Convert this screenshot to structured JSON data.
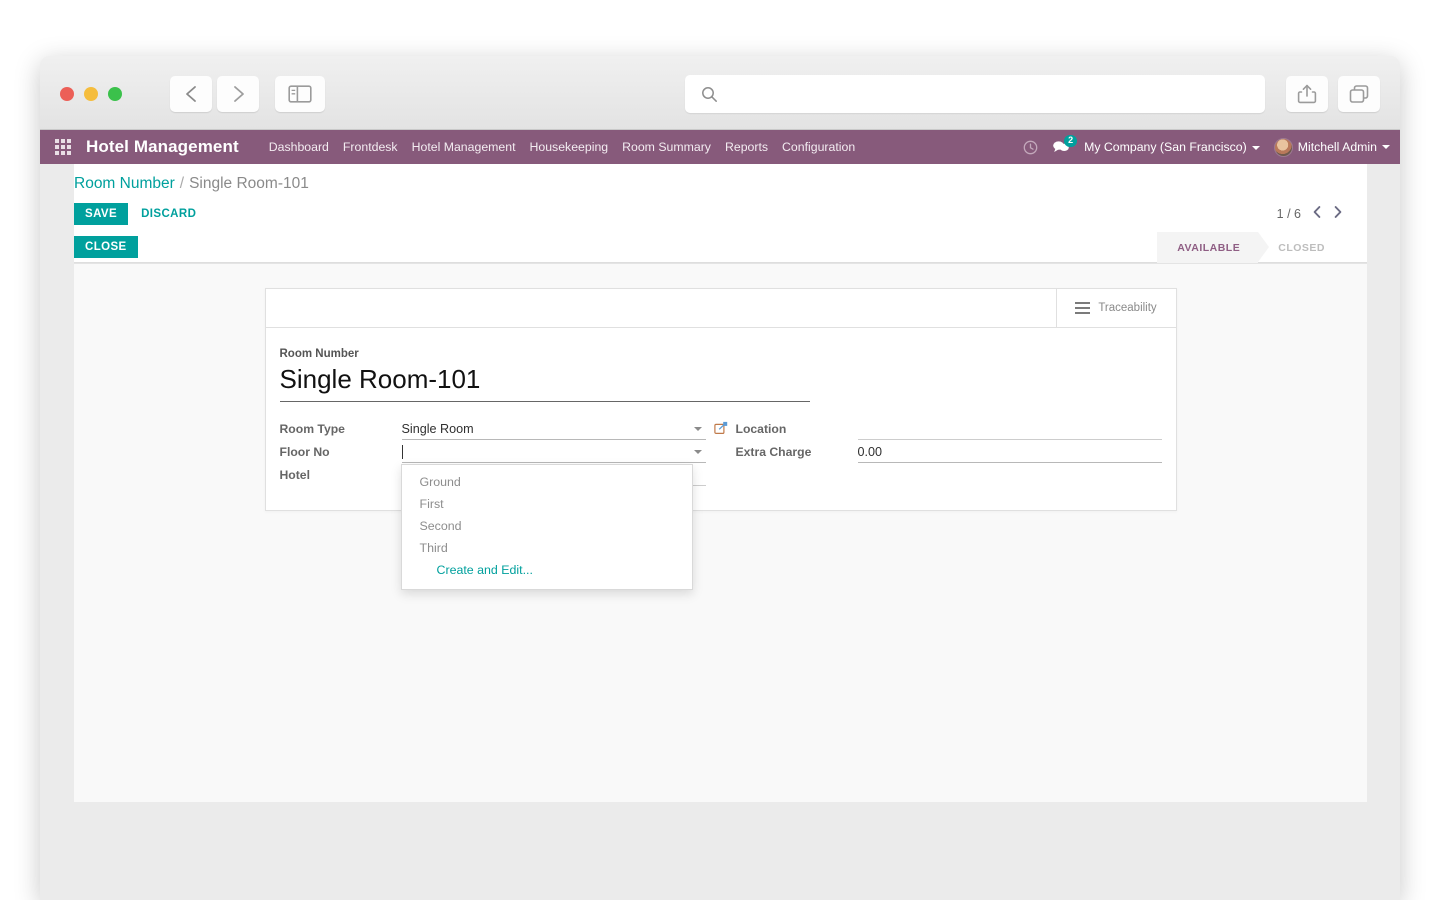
{
  "browser": {
    "search_value": "",
    "search_placeholder": "",
    "icons": {
      "back": "back-arrow-icon",
      "forward": "forward-arrow-icon",
      "sidebar": "sidebar-toggle-icon",
      "search": "search-icon",
      "share": "share-icon",
      "tabs": "tabs-icon"
    }
  },
  "navbar": {
    "apps_icon": "apps-grid-icon",
    "brand": "Hotel Management",
    "menu_items": [
      {
        "label": "Dashboard"
      },
      {
        "label": "Frontdesk"
      },
      {
        "label": "Hotel Management"
      },
      {
        "label": "Housekeeping"
      },
      {
        "label": "Room Summary"
      },
      {
        "label": "Reports"
      },
      {
        "label": "Configuration"
      }
    ],
    "activities_icon": "clock-icon",
    "messages_icon": "messages-icon",
    "message_count": "2",
    "company": "My Company (San Francisco)",
    "user": "Mitchell Admin",
    "brand_color": "#875A7B",
    "badge_color": "#00A09D"
  },
  "control_panel": {
    "breadcrumb_root": "Room Number",
    "breadcrumb_sep": "/",
    "breadcrumb_current": "Single Room-101",
    "save_label": "Save",
    "discard_label": "Discard",
    "pager_value": "1 / 6",
    "pager_prev_icon": "chevron-left-icon",
    "pager_next_icon": "chevron-right-icon"
  },
  "statusbar": {
    "close_label": "Close",
    "states": [
      {
        "label": "Available",
        "active": true
      },
      {
        "label": "Closed",
        "active": false
      }
    ],
    "active_color": "#8F5E84"
  },
  "form": {
    "button_box": {
      "traceability_label": "Traceability",
      "traceability_icon": "bars-icon"
    },
    "title_label": "Room Number",
    "title_value": "Single Room-101",
    "left_fields": [
      {
        "label": "Room Type",
        "value": "Single Room",
        "type": "many2one",
        "has_ext_link": true
      },
      {
        "label": "Floor No",
        "value": "",
        "type": "many2one",
        "has_ext_link": false
      },
      {
        "label": "Hotel",
        "value": "",
        "type": "many2one",
        "has_ext_link": false
      }
    ],
    "right_fields": [
      {
        "label": "Location",
        "value": "",
        "type": "many2one"
      },
      {
        "label": "Extra Charge",
        "value": "0.00",
        "type": "float"
      }
    ],
    "floor_dropdown": {
      "options": [
        {
          "label": "Ground"
        },
        {
          "label": "First"
        },
        {
          "label": "Second"
        },
        {
          "label": "Third"
        }
      ],
      "create_label": "Create and Edit..."
    }
  }
}
